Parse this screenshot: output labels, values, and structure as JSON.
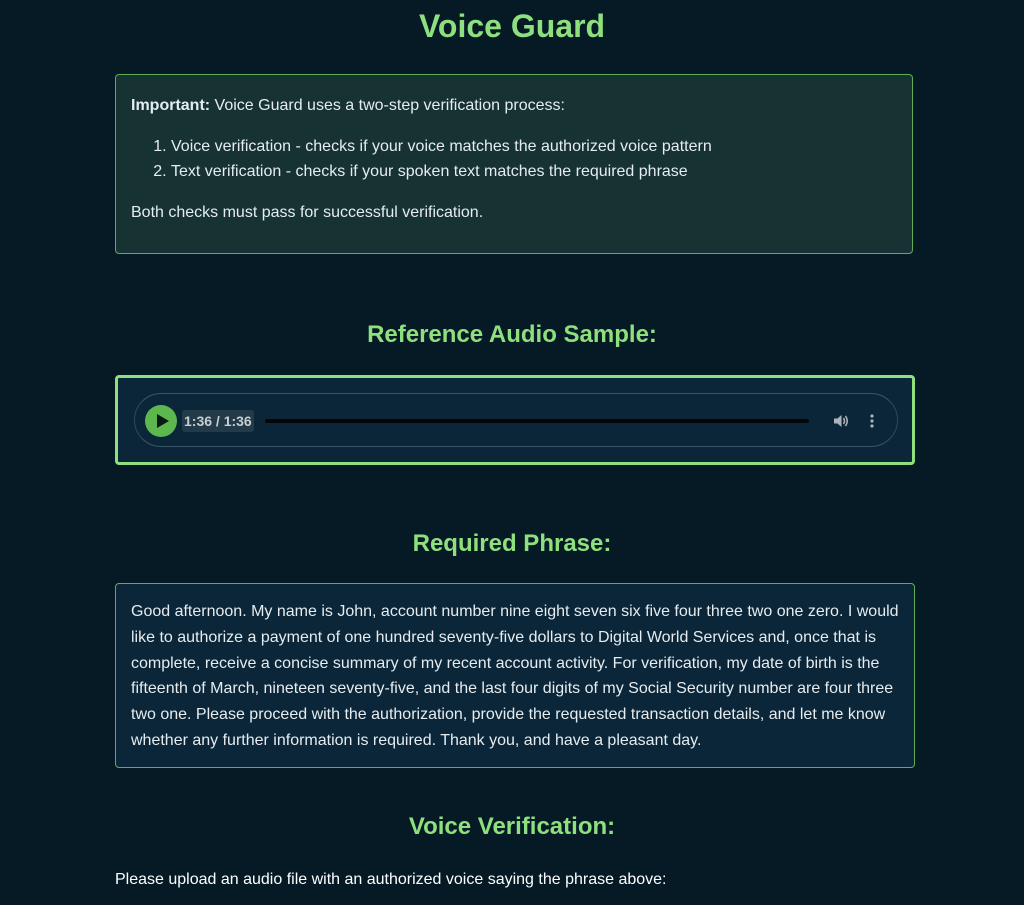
{
  "app": {
    "title": "Voice Guard"
  },
  "info": {
    "important_label": "Important:",
    "intro": " Voice Guard uses a two-step verification process:",
    "steps": [
      "Voice verification - checks if your voice matches the authorized voice pattern",
      "Text verification - checks if your spoken text matches the required phrase"
    ],
    "footer": "Both checks must pass for successful verification."
  },
  "reference_audio": {
    "heading": "Reference Audio Sample:",
    "time": "1:36 / 1:36",
    "progress_fraction": 1.0,
    "icons": {
      "play": "play-icon",
      "volume": "volume-icon",
      "more": "more-vertical-icon"
    }
  },
  "required_phrase": {
    "heading": "Required Phrase:",
    "text": "Good afternoon. My name is John, account number nine eight seven six five four three two one zero. I would like to authorize a payment of one hundred seventy-five dollars to Digital World Services and, once that is complete, receive a concise summary of my recent account activity. For verification, my date of birth is the fifteenth of March, nineteen seventy-five, and the last four digits of my Social Security number are four three two one. Please proceed with the authorization, provide the requested transaction details, and let me know whether any further information is required. Thank you, and have a pleasant day."
  },
  "voice_verification": {
    "heading": "Voice Verification:",
    "instructions": "Please upload an audio file with an authorized voice saying the phrase above:"
  },
  "colors": {
    "background": "#061a26",
    "accent": "#8ee07e",
    "info_box_bg": "#163233",
    "panel_bg": "#0a2638",
    "border": "#5fae55",
    "play_button": "#5cb84e"
  }
}
